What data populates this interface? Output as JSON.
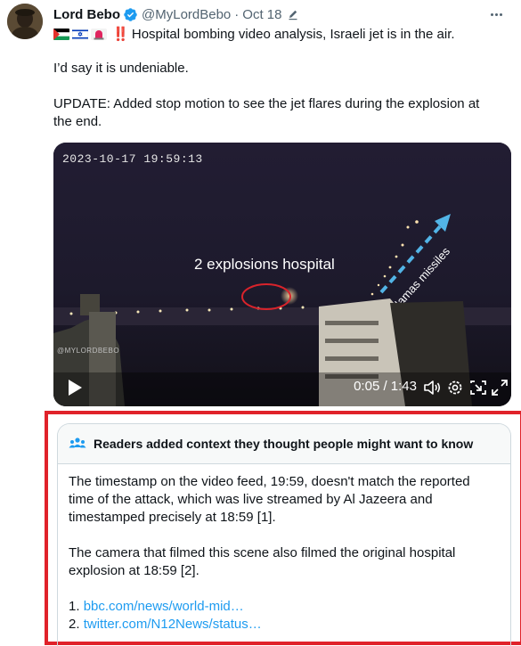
{
  "tweet": {
    "author_name": "Lord Bebo",
    "handle": "@MyLordBebo",
    "separator": "·",
    "date": "Oct 18",
    "line1_marks": "‼️",
    "line1_text": "Hospital bombing video analysis, Israeli jet is in the air.",
    "line2": "I’d say it is undeniable.",
    "line3": "UPDATE: Added stop motion to see the jet flares during the explosion at",
    "line4": "the end."
  },
  "video": {
    "timestamp": "2023-10-17 19:59:13",
    "overlay_label": "2 explosions hospital",
    "arrow_label": "Hamas missiles",
    "watermark": "@MYLORDBEBO",
    "time": "0:05 / 1:43"
  },
  "note": {
    "title": "Readers added context they thought people might want to know",
    "paragraph1_line1": "The timestamp on the video feed, 19:59, doesn't match the reported",
    "paragraph1_line2": "time of the attack, which was live streamed by Al Jazeera and",
    "paragraph1_line3": "timestamped precisely at 18:59 [1].",
    "paragraph2_line1": "The camera that filmed this scene also filmed the original hospital",
    "paragraph2_line2": "explosion at 18:59 [2].",
    "refs": [
      {
        "num": "1.",
        "link": "bbc.com/news/world-mid…"
      },
      {
        "num": "2.",
        "link": "twitter.com/N12News/status…"
      }
    ]
  },
  "icons": {
    "verified": "verified-badge-icon",
    "edit": "edit-pencil-icon",
    "more": "more-options-icon",
    "play": "play-icon",
    "volume": "volume-icon",
    "settings": "settings-gear-icon",
    "pip": "picture-in-picture-icon",
    "fullscreen": "fullscreen-icon",
    "people": "people-icon"
  },
  "colors": {
    "link": "#1d9bf0",
    "verified": "#1d9bf0",
    "highlight_border": "#e0222a",
    "muted_text": "#536471"
  }
}
